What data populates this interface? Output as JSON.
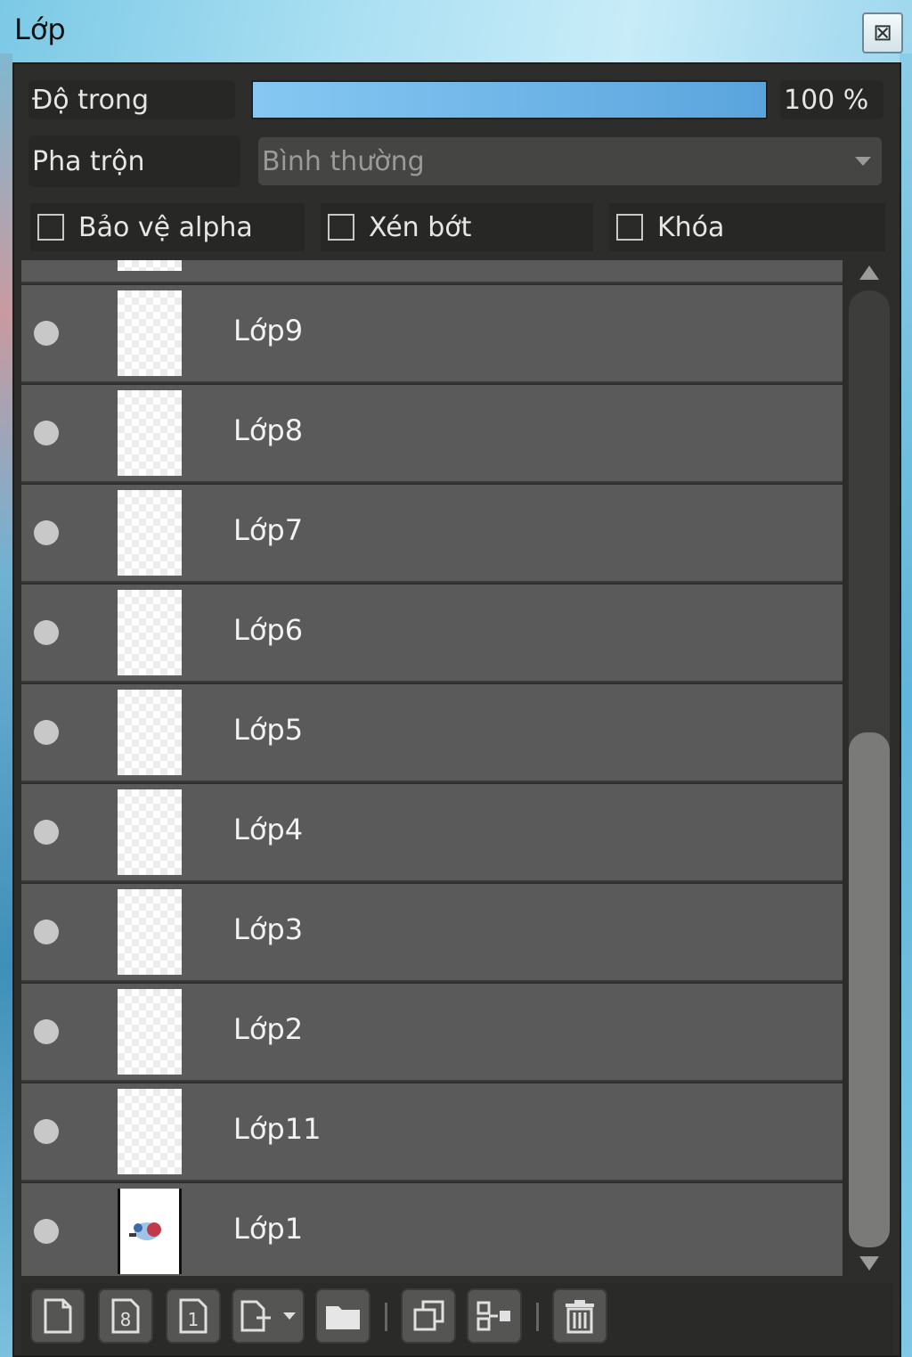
{
  "window": {
    "title": "Lớp",
    "close_symbol": "⊠"
  },
  "opacity": {
    "label": "Độ trong",
    "value_text": "100 %",
    "fill_percent": 100
  },
  "blend": {
    "label": "Pha trộn",
    "selected": "Bình thường"
  },
  "options": [
    {
      "label": "Bảo vệ alpha",
      "checked": false
    },
    {
      "label": "Xén bớt",
      "checked": false
    },
    {
      "label": "Khóa",
      "checked": false
    }
  ],
  "layers": [
    {
      "name": "Lớp9",
      "has_content": false
    },
    {
      "name": "Lớp8",
      "has_content": false
    },
    {
      "name": "Lớp7",
      "has_content": false
    },
    {
      "name": "Lớp6",
      "has_content": false
    },
    {
      "name": "Lớp5",
      "has_content": false
    },
    {
      "name": "Lớp4",
      "has_content": false
    },
    {
      "name": "Lớp3",
      "has_content": false
    },
    {
      "name": "Lớp2",
      "has_content": false
    },
    {
      "name": "Lớp11",
      "has_content": false
    },
    {
      "name": "Lớp1",
      "has_content": true
    }
  ],
  "toolbar": [
    {
      "icon": "new-layer-icon"
    },
    {
      "icon": "new-8bit-layer-icon",
      "text": "8"
    },
    {
      "icon": "new-1bit-layer-icon",
      "text": "1"
    },
    {
      "icon": "add-layer-dropdown-icon"
    },
    {
      "icon": "new-folder-icon"
    },
    {
      "icon": "duplicate-layer-icon"
    },
    {
      "icon": "merge-down-icon"
    },
    {
      "icon": "delete-layer-icon"
    }
  ],
  "colors": {
    "panel": "#2d2d2b",
    "row": "#5a5a5a",
    "slider_fill": "#6fb4e8"
  }
}
